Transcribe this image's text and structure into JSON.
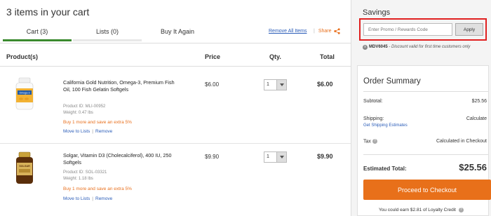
{
  "cart": {
    "title": "3 items in your cart",
    "tabs": [
      {
        "label": "Cart (3)",
        "active": true
      },
      {
        "label": "Lists (0)",
        "active": false
      },
      {
        "label": "Buy It Again",
        "active": false
      }
    ],
    "remove_all": "Remove All Items",
    "share": "Share",
    "share_separator": "|",
    "columns": {
      "product": "Product(s)",
      "price": "Price",
      "qty": "Qty.",
      "total": "Total"
    },
    "items": [
      {
        "name": "California Gold Nutrition, Omega-3, Premium Fish Oil, 100 Fish Gelatin Softgels",
        "product_id": "Product ID: MLI-00952",
        "weight": "Weight: 0.47 lbs",
        "promo": "Buy 1 more and save an extra 5%",
        "move_to_lists": "Move to Lists",
        "remove": "Remove",
        "link_separator": "|",
        "price": "$6.00",
        "qty": "1",
        "total": "$6.00",
        "image_label": "Omega-3"
      },
      {
        "name": "Solgar, Vitamin D3 (Cholecalciferol), 400 IU, 250 Softgels",
        "product_id": "Product ID: SOL-03321",
        "weight": "Weight: 1.18 lbs",
        "promo": "Buy 1 more and save an extra 5%",
        "move_to_lists": "Move to Lists",
        "remove": "Remove",
        "link_separator": "|",
        "price": "$9.90",
        "qty": "1",
        "total": "$9.90",
        "image_label": "SOLGAR"
      }
    ]
  },
  "savings": {
    "title": "Savings",
    "promo_placeholder": "Enter Promo / Rewards Code",
    "apply": "Apply",
    "remove_icon": "x",
    "applied_code": "MDV6045",
    "applied_desc": "- Discount valid for first time customers only"
  },
  "summary": {
    "title": "Order Summary",
    "subtotal_label": "Subtotal:",
    "subtotal": "$25.56",
    "shipping_label": "Shipping:",
    "shipping": "Calculate",
    "shipping_link": "Get Shipping Estimates",
    "tax_label": "Tax",
    "tax_help": "?",
    "tax": "Calculated in Checkout",
    "estimated_label": "Estimated Total:",
    "estimated": "$25.56",
    "checkout": "Proceed to Checkout",
    "loyalty": "You could earn $2.81 of Loyalty Credit",
    "loyalty_help": "?"
  },
  "colors": {
    "accent_orange": "#e8701a",
    "active_tab": "#3a8a2e",
    "link_blue": "#2a5cb8",
    "highlight_red": "#e02020"
  }
}
